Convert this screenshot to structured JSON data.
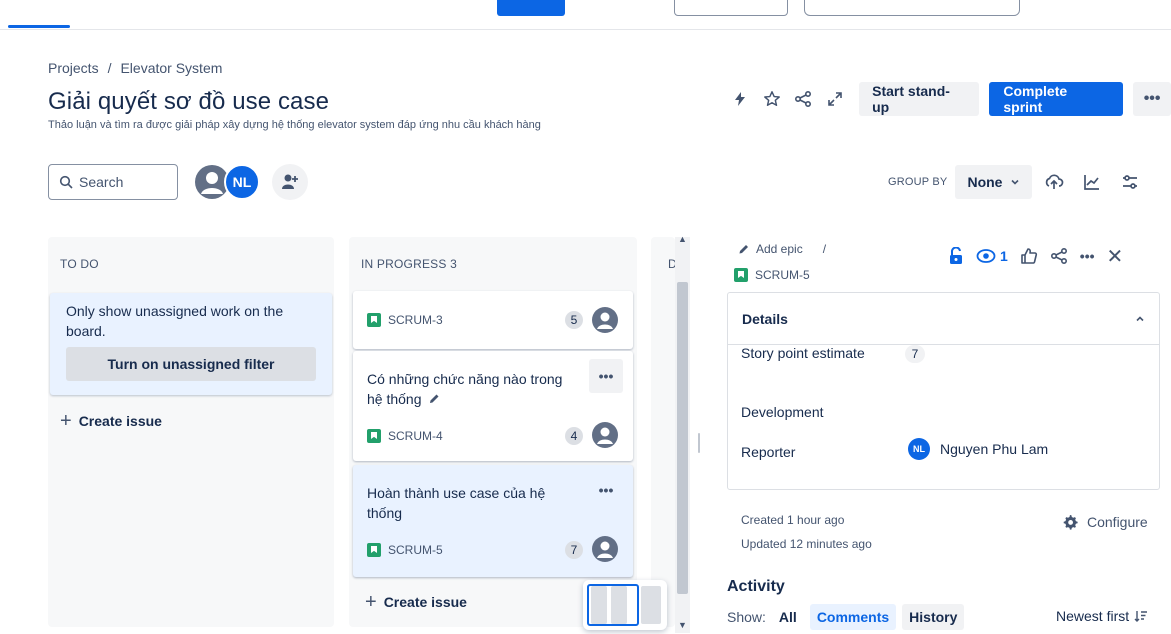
{
  "breadcrumb": {
    "root": "Projects",
    "separator": "/",
    "project": "Elevator System"
  },
  "sprint": {
    "title": "Giải quyết sơ đồ use case",
    "subtitle": "Thảo luận và tìm ra được giải pháp xây dựng hệ thống elevator system đáp ứng nhu cầu khách hàng",
    "standup_label": "Start stand-up",
    "complete_label": "Complete sprint",
    "more_label": "•••"
  },
  "filters": {
    "search_placeholder": "Search",
    "avatar_initials": "NL",
    "group_by_label": "GROUP BY",
    "group_by_value": "None"
  },
  "columns": {
    "todo": {
      "header": "TO DO",
      "empty_text": "Only show unassigned work on the board.",
      "empty_button": "Turn on unassigned filter",
      "create_label": "Create issue"
    },
    "in_progress": {
      "header": "IN PROGRESS 3",
      "create_label": "Create issue",
      "cards": [
        {
          "key": "SCRUM-3",
          "title": "",
          "points": "5"
        },
        {
          "key": "SCRUM-4",
          "title": "Có những chức năng nào trong hệ thống",
          "points": "4"
        },
        {
          "key": "SCRUM-5",
          "title": "Hoàn thành use case của hệ thống",
          "points": "7"
        }
      ]
    },
    "done": {
      "header": "D"
    }
  },
  "detail": {
    "add_epic": "Add epic",
    "separator": "/",
    "issue_key": "SCRUM-5",
    "watch_count": "1",
    "more_label": "•••",
    "close_label": "✕",
    "details_header": "Details",
    "story_points_label": "Story point estimate",
    "story_points_value": "7",
    "development_label": "Development",
    "reporter_label": "Reporter",
    "reporter_initials": "NL",
    "reporter_name": "Nguyen Phu Lam",
    "created": "Created 1 hour ago",
    "updated": "Updated 12 minutes ago",
    "configure_label": "Configure",
    "activity_header": "Activity",
    "show_label": "Show:",
    "activity_filters": [
      "All",
      "Comments",
      "History"
    ],
    "activity_filter_active": "Comments",
    "sort_label": "Newest first"
  },
  "colors": {
    "primary": "#0c66e4",
    "story": "#22a06b",
    "text": "#172b4d",
    "subtle": "#44546f"
  }
}
